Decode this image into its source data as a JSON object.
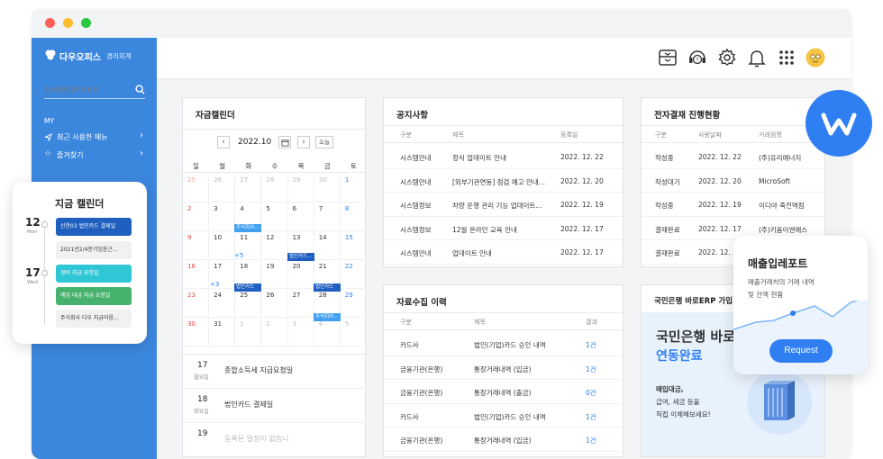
{
  "sidebar": {
    "brand": "다우오피스",
    "brand_sub": "경리회계",
    "search_placeholder": "검색어를 입력하세요.",
    "section": "MY",
    "items": [
      {
        "label": "최근 사용한 메뉴"
      },
      {
        "label": "즐겨찾기"
      }
    ]
  },
  "calendar": {
    "title": "자금캘린더",
    "month": "2022.10",
    "today": "오늘",
    "weekdays": [
      "일",
      "월",
      "화",
      "수",
      "목",
      "금",
      "토"
    ],
    "weeks": [
      [
        "25",
        "26",
        "27",
        "28",
        "29",
        "30",
        "1"
      ],
      [
        "2",
        "3",
        "4",
        "5",
        "6",
        "7",
        "8"
      ],
      [
        "9",
        "10",
        "11",
        "12",
        "13",
        "14",
        "15"
      ],
      [
        "16",
        "17",
        "18",
        "19",
        "20",
        "21",
        "22"
      ],
      [
        "23",
        "24",
        "25",
        "26",
        "27",
        "28",
        "29"
      ],
      [
        "30",
        "31",
        "1",
        "2",
        "3",
        "4",
        "5"
      ]
    ],
    "chips": {
      "c1": "주식회사...",
      "c2": "주식회사...",
      "c3": "법인카드...",
      "c4": "법인카드",
      "c5": "법인카드",
      "c6": "주식회사..."
    },
    "more": {
      "m1": "+5",
      "m2": "+3"
    },
    "agenda": [
      {
        "day": "17",
        "dow": "월요일",
        "text": "종합소득세 지급요청일"
      },
      {
        "day": "18",
        "dow": "화요일",
        "text": "법인카드 결제일"
      },
      {
        "day": "19",
        "dow": "",
        "text": "등록된 일정이 없습니"
      }
    ]
  },
  "notice": {
    "title": "공지사항",
    "headers": [
      "구분",
      "제목",
      "등록일"
    ],
    "rows": [
      [
        "시스템안내",
        "정식 업데이트 안내",
        "2022. 12. 22"
      ],
      [
        "시스템안내",
        "[외부기관연동] 점검 예고 안내...",
        "2022. 12. 20"
      ],
      [
        "시스템정보",
        "차량 운행 관리 기능 업데이트...",
        "2022. 12. 19"
      ],
      [
        "시스템정보",
        "12월 온라인 교육 안내",
        "2022. 12. 17"
      ],
      [
        "시스템안내",
        "업데이트 안내",
        "2022. 12. 17"
      ]
    ]
  },
  "approval": {
    "title": "전자결재 진행현황",
    "headers": [
      "구분",
      "사용날짜",
      "거래점명"
    ],
    "rows": [
      [
        "작성중",
        "2022. 12. 22",
        "(주)유리에너지"
      ],
      [
        "작성대기",
        "2022. 12. 20",
        "MicroSoft"
      ],
      [
        "작성중",
        "2022. 12. 19",
        "이디야 죽전역점"
      ],
      [
        "결재완료",
        "2022. 12. 17",
        "(주)키움이엔에스"
      ],
      [
        "결재완료",
        "2022. 12. 17",
        ""
      ]
    ]
  },
  "collection": {
    "title": "자료수집 이력",
    "headers": [
      "구분",
      "제목",
      "결과"
    ],
    "rows": [
      [
        "카드사",
        "법인(기업)카드 승인 내역",
        "1건"
      ],
      [
        "금융기관(은행)",
        "통장거래내역 (입금)",
        "1건"
      ],
      [
        "금융기관(은행)",
        "통장거래내역 (출금)",
        "0건"
      ],
      [
        "카드사",
        "법인(기업)카드 승인 내역",
        "1건"
      ],
      [
        "금융기관(은행)",
        "통장거래내역 (입금)",
        "1건"
      ]
    ]
  },
  "bank": {
    "title": "국민은행 바로ERP 가입",
    "headline": "국민은행 바로",
    "headline2": "연동완료",
    "desc1": "매입대금,",
    "desc2": "급여, 세금 등을",
    "desc3": "직접 이체해보세요!"
  },
  "popup": {
    "title": "지금 캘린더",
    "items": [
      {
        "day": "12",
        "dow": "Mon",
        "events": [
          "신한03 법인카드 결제일",
          "2021년2/4분기임윤근..."
        ]
      },
      {
        "day": "17",
        "dow": "Wed",
        "events": [
          "경비 지급 요청일",
          "매입 대금 지급 요청일",
          "주식회사 다우 지급어음..."
        ]
      }
    ]
  },
  "report": {
    "title": "매출입레포트",
    "desc1": "매출거래처의 거래 내역",
    "desc2": "및 잔액 현황",
    "button": "Request"
  },
  "colors": {
    "sidebar": "#3c87de",
    "accent": "#2f7ff2",
    "chip_blue": "#1f5fc0",
    "chip_cyan": "#2fc7d6",
    "chip_green": "#47b26e"
  }
}
